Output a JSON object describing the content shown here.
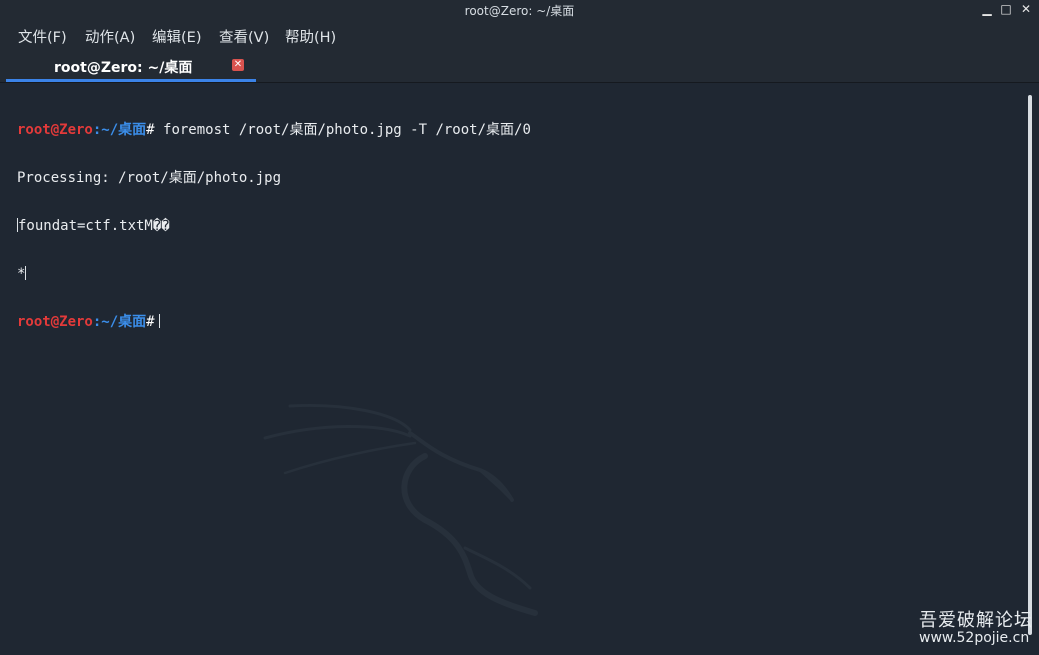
{
  "window": {
    "title": "root@Zero: ~/桌面",
    "buttons": {
      "minimize": "▁",
      "maximize": "□",
      "close": "✕"
    }
  },
  "menu": {
    "items": [
      "文件(F)",
      "动作(A)",
      "编辑(E)",
      "查看(V)",
      "帮助(H)"
    ]
  },
  "tab": {
    "label": "root@Zero: ~/桌面",
    "close_symbol": "✕"
  },
  "terminal": {
    "prompt_user": "root@Zero",
    "prompt_path": ":~/桌面",
    "prompt_hash": "#",
    "line1_command": " foremost /root/桌面/photo.jpg -T /root/桌面/0",
    "line2_text": "Processing: /root/桌面/photo.jpg",
    "line3_text": "foundat=ctf.txtM��",
    "line4_text": "*"
  },
  "watermark": {
    "line1": "吾爱破解论坛",
    "line2": "www.52pojie.cn"
  },
  "icons": {
    "background_logo": "kali-dragon-icon"
  }
}
